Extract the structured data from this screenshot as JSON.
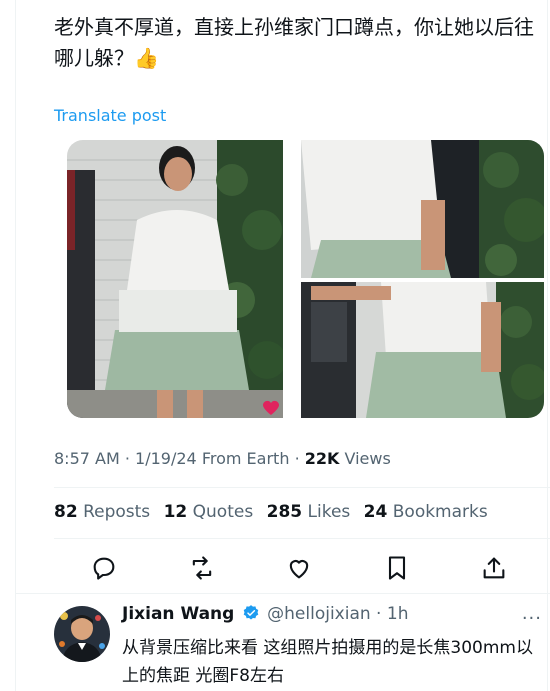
{
  "post": {
    "text": "老外真不厚道，直接上孙维家门口蹲点，你让她以后往哪儿躲？👍",
    "translate_label": "Translate post"
  },
  "meta": {
    "time": "8:57 AM",
    "date": "1/19/24",
    "source": "From Earth",
    "views_count": "22K",
    "views_label": "Views"
  },
  "stats": [
    {
      "count": "82",
      "label": "Reposts"
    },
    {
      "count": "12",
      "label": "Quotes"
    },
    {
      "count": "285",
      "label": "Likes"
    },
    {
      "count": "24",
      "label": "Bookmarks"
    }
  ],
  "actions": [
    "reply-icon",
    "repost-icon",
    "like-icon",
    "bookmark-icon",
    "share-icon"
  ],
  "reply": {
    "name": "Jixian Wang",
    "handle": "@hellojixian",
    "time": "1h",
    "text": "从背景压缩比来看 这组照片拍摄用的是长焦300mm以上的焦距 光圈F8左右"
  },
  "colors": {
    "accent": "#1d9bf0",
    "text": "#0f1419",
    "secondary": "#536471",
    "verified": "#1d9bf0"
  }
}
